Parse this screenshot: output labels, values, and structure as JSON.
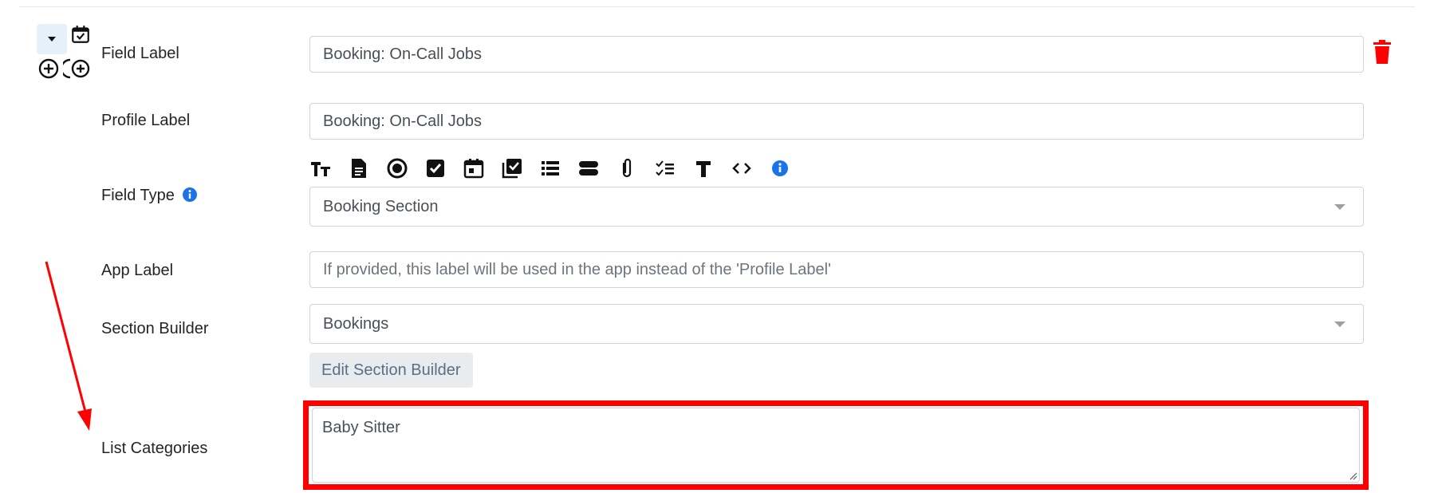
{
  "labels": {
    "field_label": "Field Label",
    "profile_label": "Profile Label",
    "field_type": "Field Type",
    "app_label": "App Label",
    "section_builder": "Section Builder",
    "list_categories": "List Categories"
  },
  "inputs": {
    "field_label_value": "Booking:  On-Call Jobs",
    "profile_label_value": "Booking:  On-Call Jobs",
    "field_type_selected": "Booking Section",
    "app_label_placeholder": "If provided, this label will be used in the app instead of the 'Profile Label'",
    "section_builder_selected": "Bookings",
    "list_categories_value": "Baby Sitter"
  },
  "buttons": {
    "edit_section_builder": "Edit Section Builder"
  },
  "toolbar_icons": [
    "text-size-icon",
    "document-icon",
    "radio-icon",
    "checkbox-icon",
    "calendar-icon",
    "checkbox-list-icon",
    "list-icon",
    "toggle-icon",
    "paperclip-icon",
    "checklist-icon",
    "text-icon",
    "code-icon",
    "info-icon"
  ],
  "colors": {
    "highlight_red": "#ff0000",
    "info_blue": "#1a73e8",
    "delete_red": "#ff0000",
    "collapse_bg": "#e6f0fb"
  }
}
